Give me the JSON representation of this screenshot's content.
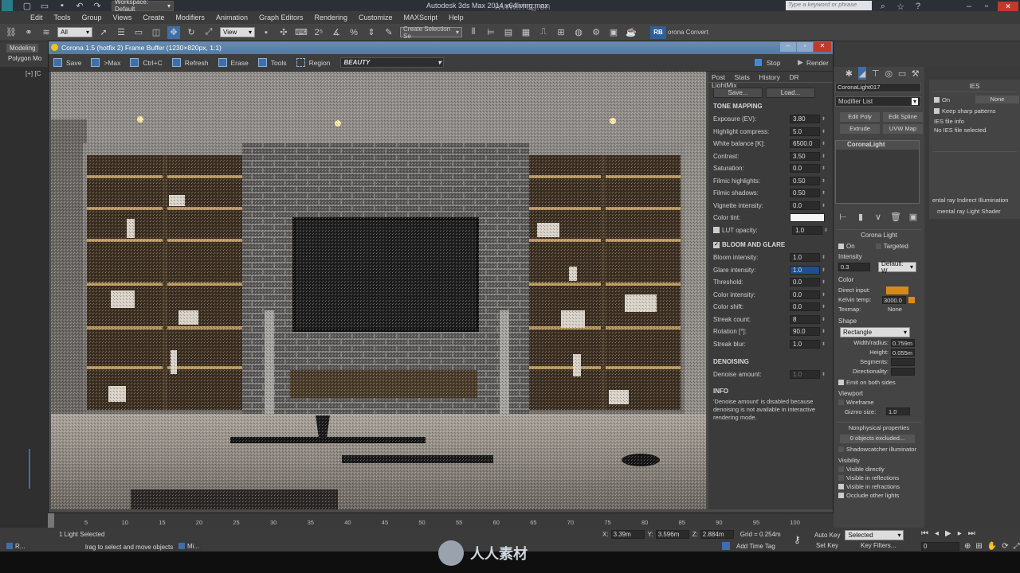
{
  "app_title": "Autodesk 3ds Max  2014 x64",
  "file_name": "living.max",
  "workspace": "Workspace: Default",
  "search_placeholder": "Type a keyword or phrase",
  "watermark_text": "www.rrcg.cn",
  "menus": [
    "Edit",
    "Tools",
    "Group",
    "Views",
    "Create",
    "Modifiers",
    "Animation",
    "Graph Editors",
    "Rendering",
    "Customize",
    "MAXScript",
    "Help"
  ],
  "toolbar": {
    "filter_value": "All",
    "view_value": "View",
    "selection_set": "Create Selection Se",
    "rb_label": "RB",
    "corona_convert": "orona Convert"
  },
  "ribbon_tabs": [
    "Modeling",
    "Polygon Mo"
  ],
  "viewport_label": "[+] [C",
  "framebuffer": {
    "title": "Corona 1.5 (hotfix 2) Frame Buffer (1230×820px, 1:1)",
    "tools": [
      "Save",
      ">Max",
      "Ctrl+C",
      "Refresh",
      "Erase",
      "Tools",
      "Region"
    ],
    "channel": "BEAUTY",
    "stop_label": "Stop",
    "render_label": "Render",
    "tabs": [
      "Post",
      "Stats",
      "History",
      "DR",
      "LightMix"
    ],
    "save_btn": "Save...",
    "load_btn": "Load...",
    "tone_mapping_title": "TONE MAPPING",
    "tone_mapping": [
      {
        "label": "Exposure (EV):",
        "value": "3.80"
      },
      {
        "label": "Highlight compress:",
        "value": "5.0"
      },
      {
        "label": "White balance [K]:",
        "value": "6500.0"
      },
      {
        "label": "Contrast:",
        "value": "3.50"
      },
      {
        "label": "Saturation:",
        "value": "0.0"
      },
      {
        "label": "Filmic highlights:",
        "value": "0.50"
      },
      {
        "label": "Filmic shadows:",
        "value": "0.50"
      },
      {
        "label": "Vignette intensity:",
        "value": "0.0"
      },
      {
        "label": "Color tint:",
        "value": ""
      },
      {
        "label": "LUT opacity:",
        "value": "1.0"
      }
    ],
    "bloom_title": "BLOOM AND GLARE",
    "bloom": [
      {
        "label": "Bloom intensity:",
        "value": "1.0"
      },
      {
        "label": "Glare intensity:",
        "value": "1.0"
      },
      {
        "label": "Threshold:",
        "value": "0.0"
      },
      {
        "label": "Color intensity:",
        "value": "0.0"
      },
      {
        "label": "Color shift:",
        "value": "0.0"
      },
      {
        "label": "Streak count:",
        "value": "8"
      },
      {
        "label": "Rotation [°]:",
        "value": "90.0"
      },
      {
        "label": "Streak blur:",
        "value": "1.0"
      }
    ],
    "denoising_title": "DENOISING",
    "denoise_label": "Denoise amount:",
    "denoise_value": "1.0",
    "info_title": "INFO",
    "info_text": "'Denoise amount' is disabled because denoising is not available in interactive rendering mode."
  },
  "command_panel": {
    "object_name": "CoronaLight017",
    "modifier_list": "Modifier List",
    "buttons": [
      "Edit Poly",
      "Edit Spline",
      "Extrude",
      "UVW Map"
    ],
    "stack_item": "CoronaLight",
    "rollout_title": "Corona Light",
    "on_label": "On",
    "targeted_label": "Targeted",
    "intensity_label": "Intensity",
    "intensity_value": "0.3",
    "intensity_unit": "Default: W",
    "color_label": "Color",
    "direct_input": "Direct input:",
    "kelvin_temp": "Kelvin temp:",
    "kelvin_value": "3000.0",
    "texmap": "Texmap:",
    "texmap_value": "None",
    "shape_label": "Shape",
    "shape_value": "Rectangle",
    "width_label": "Width/radius:",
    "width_value": "0.759m",
    "height_label": "Height:",
    "height_value": "0.055m",
    "segments_label": "Segments:",
    "directionality_label": "Directionality:",
    "emit_both": "Emit on both sides",
    "viewport_label": "Viewport",
    "wireframe": "Wireframe",
    "gizmo_label": "Gizmo size:",
    "gizmo_value": "1.0",
    "nonphysical": "Nonphysical properties",
    "objects_excluded": "0 objects excluded...",
    "shadowcatcher": "Shadowcatcher illuminator",
    "visibility_label": "Visibility",
    "visibility": [
      "Visible directly",
      "Visible in reflections",
      "Visible in refractions",
      "Occlude other lights"
    ]
  },
  "ies_panel": {
    "title": "IES",
    "on_label": "On",
    "on_value": "None",
    "keep_sharp": "Keep sharp patterns",
    "file_info": "IES file info",
    "no_file": "No IES file selected.",
    "mr_items": [
      "ental ray Indirect Illumination",
      "mental ray Light Shader"
    ]
  },
  "timeline_ticks": [
    "5",
    "10",
    "15",
    "20",
    "25",
    "30",
    "35",
    "40",
    "45",
    "50",
    "55",
    "60",
    "65",
    "70",
    "75",
    "80",
    "85",
    "90",
    "95",
    "100"
  ],
  "status": {
    "selected": "1 Light Selected",
    "prompt": "lrag to select and move objects",
    "x_label": "X:",
    "x_value": "3.39m",
    "y_label": "Y:",
    "y_value": "3.596m",
    "z_label": "Z:",
    "z_value": "2.884m",
    "grid": "Grid = 0.254m",
    "add_time_tag": "Add Time Tag",
    "auto_key": "Auto Key",
    "selected_dd": "Selected",
    "set_key": "Set Key",
    "key_filters": "Key Filters...",
    "frame_value": "0",
    "taskbar_items": [
      "R...",
      "Mi..."
    ],
    "brand": "人人素材"
  },
  "colors": {
    "accent": "#557aa0",
    "kelvin": "#e08a1c",
    "direct": "#d58a1a"
  }
}
